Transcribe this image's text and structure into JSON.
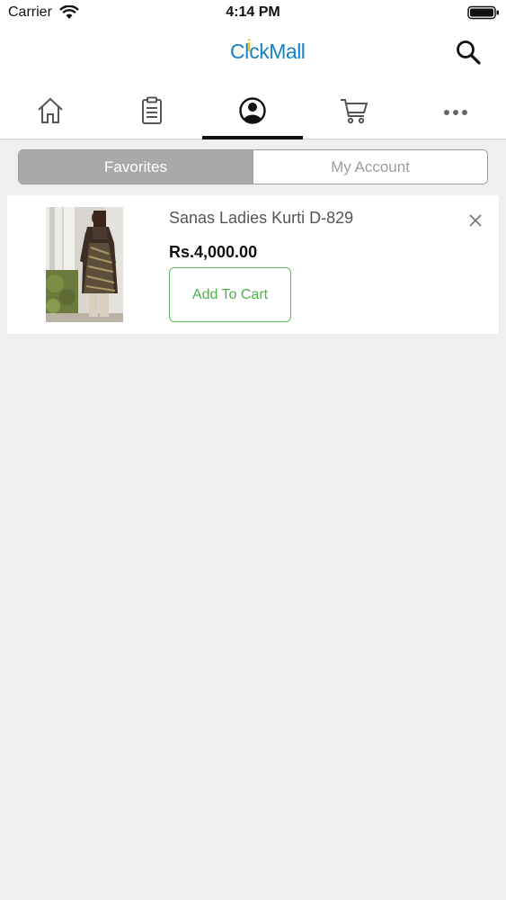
{
  "status_bar": {
    "carrier": "Carrier",
    "time": "4:14 PM"
  },
  "header": {
    "logo_part1": "Cl",
    "logo_accent": "i",
    "logo_part2": "ckMall"
  },
  "tabs": [
    {
      "icon": "home-icon"
    },
    {
      "icon": "clipboard-icon"
    },
    {
      "icon": "user-icon",
      "active": true
    },
    {
      "icon": "cart-icon"
    },
    {
      "icon": "more-icon"
    }
  ],
  "segment": {
    "favorites": "Favorites",
    "my_account": "My Account",
    "selected": "Favorites"
  },
  "favorites": [
    {
      "name": "Sanas Ladies Kurti D-829",
      "price": "Rs.4,000.00",
      "button": "Add To Cart"
    }
  ],
  "colors": {
    "brand_blue": "#1583c8",
    "brand_yellow": "#f2c12e",
    "add_cart_green": "#4fb04f",
    "segment_active": "#a9a9ab",
    "background": "#efeff1"
  }
}
